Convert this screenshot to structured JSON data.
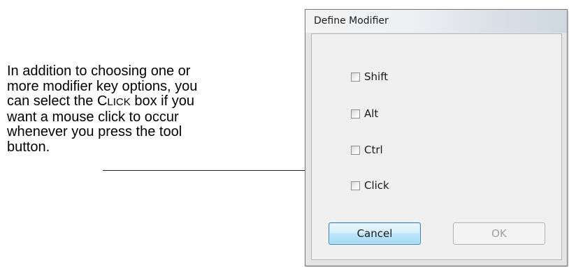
{
  "annotation": {
    "lines": [
      "In addition to choosing one or",
      "more modifier key options, you",
      "can select the ",
      " box if you",
      "want a mouse click to occur",
      "whenever you press the tool",
      "button."
    ],
    "click_first": "C",
    "click_rest": "LICK"
  },
  "dialog": {
    "title": "Define Modifier",
    "checkboxes": [
      {
        "label": "Shift",
        "checked": false
      },
      {
        "label": "Alt",
        "checked": false
      },
      {
        "label": "Ctrl",
        "checked": false
      },
      {
        "label": "Click",
        "checked": false
      }
    ],
    "buttons": {
      "cancel": "Cancel",
      "ok": "OK",
      "ok_enabled": false
    }
  },
  "colors": {
    "focus_button_border": "#3c7fb1",
    "disabled_text": "#a0a0a0"
  }
}
